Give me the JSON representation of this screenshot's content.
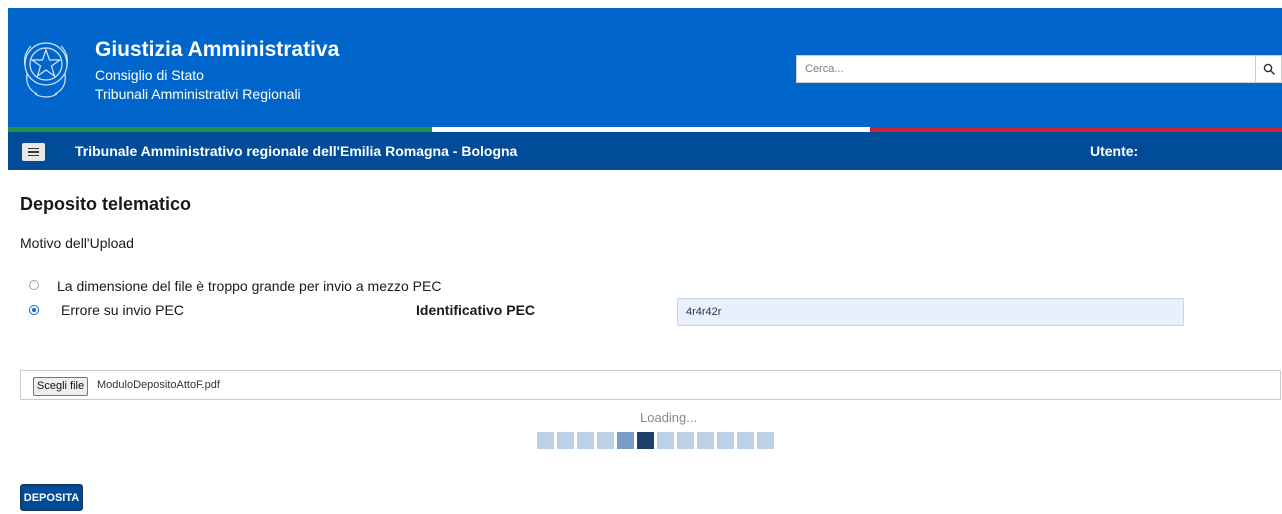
{
  "header": {
    "title": "Giustizia Amministrativa",
    "subtitle_1": "Consiglio di Stato",
    "subtitle_2": "Tribunali Amministrativi Regionali",
    "search_placeholder": "Cerca..."
  },
  "navbar": {
    "title": "Tribunale Amministrativo regionale dell'Emilia Romagna - Bologna",
    "user_label": "Utente:"
  },
  "page": {
    "title": "Deposito telematico",
    "motivo_label": "Motivo dell'Upload"
  },
  "options": [
    {
      "label": "La dimensione del file è troppo grande per invio a mezzo PEC",
      "selected": false
    },
    {
      "label": "Errore su invio PEC",
      "selected": true
    }
  ],
  "pec": {
    "label": "Identificativo PEC",
    "value": "4r4r42r"
  },
  "file": {
    "button_label": "Scegli file",
    "file_name": "ModuloDepositoAttoF.pdf"
  },
  "loading": {
    "text": "Loading...",
    "active_step": 6,
    "steps": 12
  },
  "actions": {
    "deposita_label": "DEPOSITA"
  },
  "colors": {
    "header_blue": "#0066cc",
    "navbar_blue": "#004c99",
    "flag_green": "#24934a",
    "flag_white": "#ffffff",
    "flag_red": "#cc2236",
    "pec_input_bg": "#e8f0fe"
  },
  "icons": {
    "emblem": "emblem-icon",
    "search": "search-icon",
    "menu": "hamburger-menu-icon"
  }
}
